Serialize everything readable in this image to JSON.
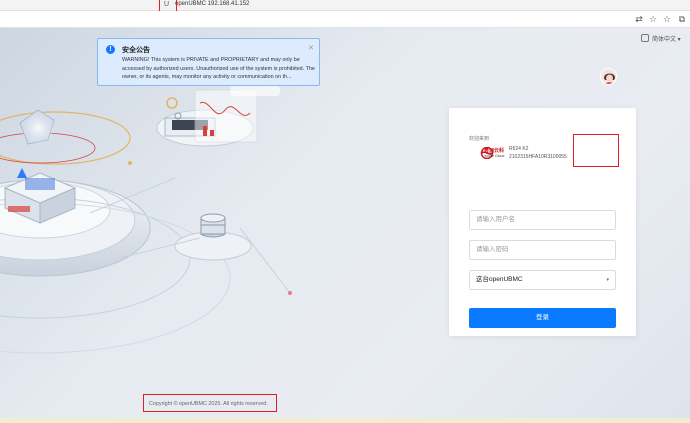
{
  "browser": {
    "tab_title": "openUBMC 192.168.41.152",
    "favicon": "U",
    "toolbar_icons": [
      "translate-icon",
      "star-icon",
      "favorites-icon",
      "extensions-icon",
      "profile-icon"
    ]
  },
  "notice": {
    "title": "安全公告",
    "body": "WARNING! This system is PRIVATE and PROPRIETARY and may only be accessed by authorized users. Unauthorized use of the system is prohibited. The owner, or its agents, may monitor any activity or communication on th..."
  },
  "header": {
    "language": "简体中文"
  },
  "login": {
    "welcome": "欢迎来到",
    "brand_cn": "粤洲云科",
    "brand_en": "Yueke Cloud",
    "model": "R624 K2",
    "serial": "2102315HFA10R3100055",
    "username_placeholder": "请输入用户名",
    "password_placeholder": "请输入密码",
    "domain_selected": "这台openUBMC",
    "submit_label": "登录"
  },
  "footer": {
    "copyright": "Copyright © openUBMC 2025. All rights reserved."
  },
  "colors": {
    "primary": "#0a7bff",
    "notice_bg": "#dcebfd",
    "highlight_box": "#e02020"
  }
}
